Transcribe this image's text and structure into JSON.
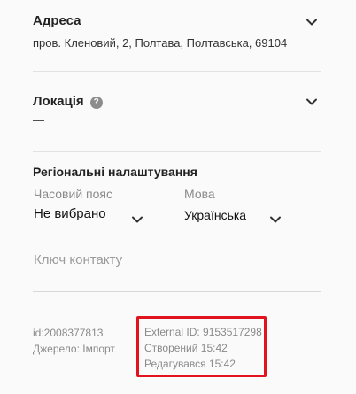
{
  "address": {
    "title": "Адреса",
    "value": "пров. Кленовий, 2, Полтава, Полтавська, 69104"
  },
  "location": {
    "title": "Локація",
    "help_symbol": "?",
    "value": "—"
  },
  "regional": {
    "title": "Регіональні налаштування",
    "timezone_label": "Часовий пояс",
    "timezone_value": "Не вибрано",
    "language_label": "Мова",
    "language_value": "Українська"
  },
  "contact_key": {
    "placeholder": "Ключ контакту"
  },
  "meta": {
    "id": "id:2008377813",
    "source": "Джерело: Імпорт",
    "external_id": "External ID: 9153517298",
    "created": "Створений 15:42",
    "edited": "Редагувався 15:42"
  },
  "colors": {
    "highlight": "#e0131f",
    "muted_text": "#8a8a8a",
    "divider": "#e2e2e2"
  },
  "icons": [
    "chevron-down-icon",
    "help-icon"
  ]
}
